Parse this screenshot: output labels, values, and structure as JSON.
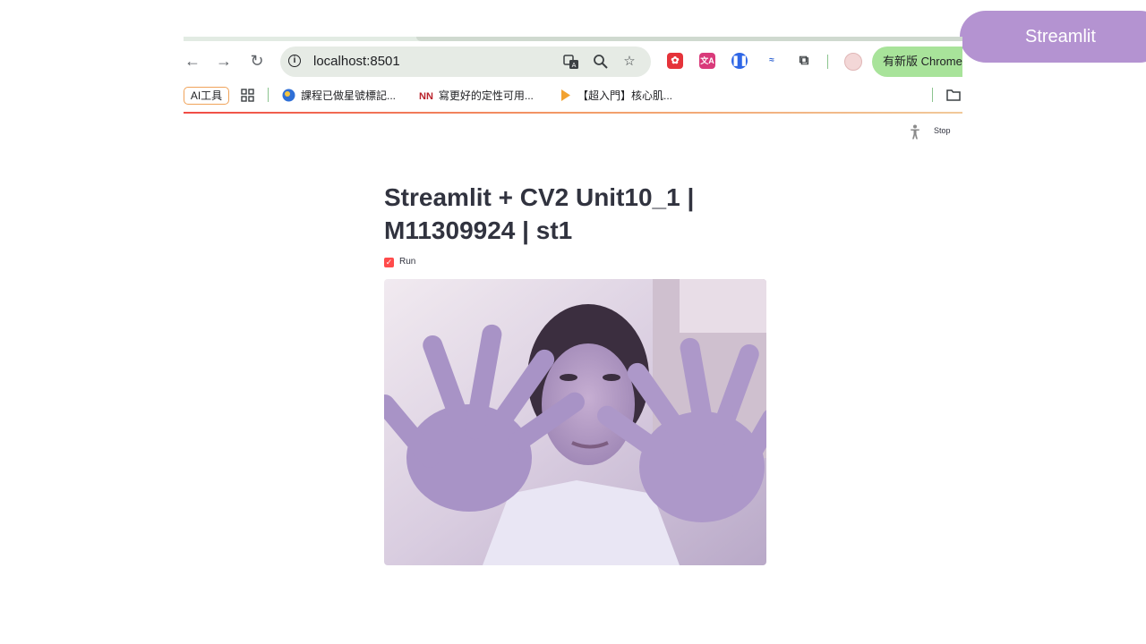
{
  "slide_tag": "Streamlit",
  "browser": {
    "url": "localhost:8501",
    "update_button": "有新版 Chrome 可用",
    "bookmarks": {
      "ai_chip": "AI工具",
      "items": [
        {
          "label": "課程已做星號標記..."
        },
        {
          "label": "寫更好的定性可用..."
        },
        {
          "label": "【超入門】核心肌..."
        }
      ],
      "nn_logo": "NN"
    },
    "extensions": [
      {
        "icon": "strawberry-extension-icon",
        "color": "#e5333a"
      },
      {
        "icon": "translate-extension-icon",
        "color": "#d93a7a",
        "glyph": "文A"
      },
      {
        "icon": "pause-extension-icon",
        "color": "#2e66e6"
      },
      {
        "icon": "sumo-extension-icon",
        "color": "#ffffff"
      }
    ]
  },
  "app": {
    "title": "Streamlit + CV2 Unit10_1 | M11309924 | st1",
    "stop_label": "Stop",
    "checkbox_label": "Run",
    "checkbox_checked": true
  },
  "colors": {
    "slide_tag": "#b493d1",
    "streamlit_accent": "#ff4b4b",
    "text": "#31333f",
    "update_pill": "#a8e39a"
  }
}
